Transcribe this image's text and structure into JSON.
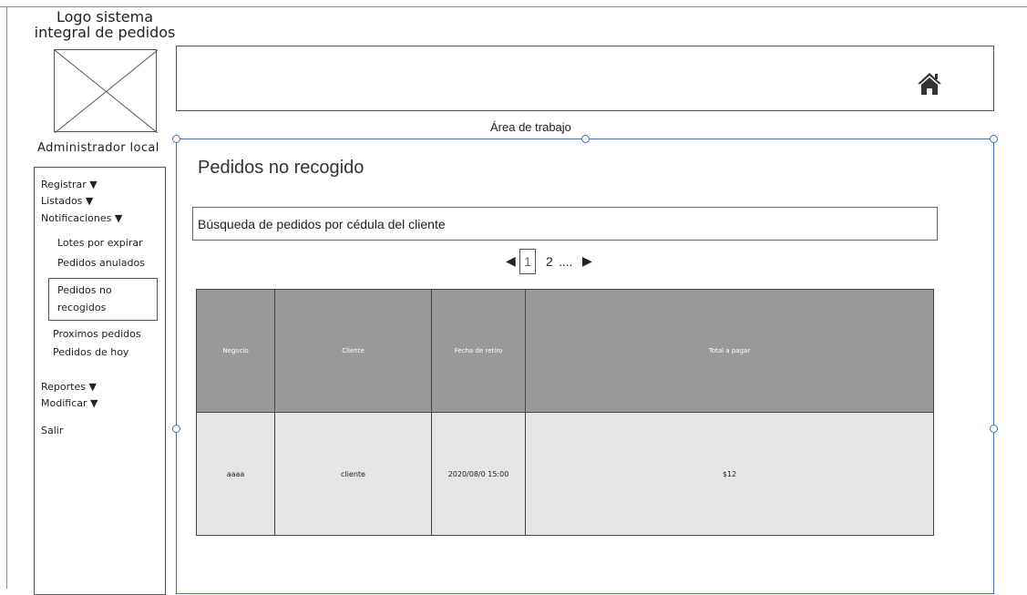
{
  "logo": {
    "text": "Logo sistema integral de pedidos"
  },
  "header": {
    "home_icon": "home-icon"
  },
  "work_area": {
    "label": "Área de trabajo"
  },
  "user": {
    "role": "Administrador local"
  },
  "sidebar": {
    "items": [
      {
        "label": "Registrar ▼"
      },
      {
        "label": "Listados ▼"
      },
      {
        "label": "Notificaciones ▼"
      },
      {
        "label": "Lotes por expirar"
      },
      {
        "label": "Pedidos anulados"
      },
      {
        "label": "Pedidos no recogidos"
      },
      {
        "label": "Proximos pedidos"
      },
      {
        "label": "Pedidos de hoy"
      },
      {
        "label": "Reportes ▼"
      },
      {
        "label": "Modificar ▼"
      },
      {
        "label": "Salir"
      }
    ]
  },
  "main": {
    "title": "Pedidos no recogido",
    "search": {
      "placeholder": "Búsqueda de pedidos por cédula del cliente"
    },
    "pagination": {
      "current": "1",
      "next_page": "2",
      "ellipsis": "...."
    },
    "table": {
      "headers": [
        "Negocio",
        "Cliente",
        "Fecha de retiro",
        "Total a pagar"
      ],
      "rows": [
        [
          "aaaa",
          "cliente",
          "2020/08/0 15:00",
          "$12"
        ]
      ]
    }
  }
}
